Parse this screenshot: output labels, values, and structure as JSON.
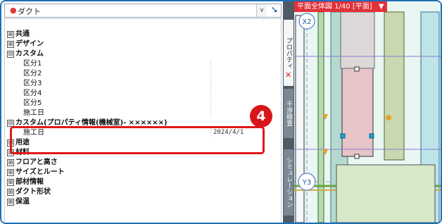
{
  "panel": {
    "selector_dot": "●",
    "selector_value": "ダクト",
    "dropdown_glyph": "∨",
    "arrow_glyph": "➘"
  },
  "rows": [
    {
      "toggle": "⊞",
      "label": "共通",
      "type": "category"
    },
    {
      "toggle": "⊞",
      "label": "デザイン",
      "type": "category"
    },
    {
      "toggle": "⊟",
      "label": "カスタム",
      "type": "category"
    },
    {
      "label": "区分1",
      "type": "prop",
      "value": ""
    },
    {
      "label": "区分2",
      "type": "prop",
      "value": ""
    },
    {
      "label": "区分3",
      "type": "prop",
      "value": ""
    },
    {
      "label": "区分4",
      "type": "prop",
      "value": ""
    },
    {
      "label": "区分5",
      "type": "prop",
      "value": ""
    },
    {
      "label": "施工日",
      "type": "prop",
      "value": ""
    },
    {
      "toggle": "⊟",
      "label": "カスタム(プロパティ情報(機械室)- ××××××)",
      "type": "category"
    },
    {
      "label": "施工日",
      "type": "prop",
      "value": "2024/4/1"
    },
    {
      "toggle": "⊞",
      "label": "用途",
      "type": "category"
    },
    {
      "toggle": "⊞",
      "label": "材料",
      "type": "category"
    },
    {
      "toggle": "⊞",
      "label": "フロアと高さ",
      "type": "category"
    },
    {
      "toggle": "⊞",
      "label": "サイズとルート",
      "type": "category"
    },
    {
      "toggle": "⊞",
      "label": "部材情報",
      "type": "category"
    },
    {
      "toggle": "⊞",
      "label": "ダクト形状",
      "type": "category"
    },
    {
      "toggle": "⊞",
      "label": "保温",
      "type": "category"
    }
  ],
  "callout": {
    "number": "4"
  },
  "vertical_tabs": [
    {
      "label": "プロパティ",
      "close": "✕",
      "active": true
    },
    {
      "label": "干渉検査",
      "active": false
    },
    {
      "label": "シミュレーション",
      "active": false
    }
  ],
  "view": {
    "title": "平面全体図 1/40 [平面]",
    "menu_glyph": "▼",
    "grid_labels": [
      "X2",
      "Y3"
    ]
  },
  "colors": {
    "highlight": "#e01818",
    "badge": "#d8161a",
    "view_header": "#e2303a",
    "frame": "#1e6fb8"
  }
}
